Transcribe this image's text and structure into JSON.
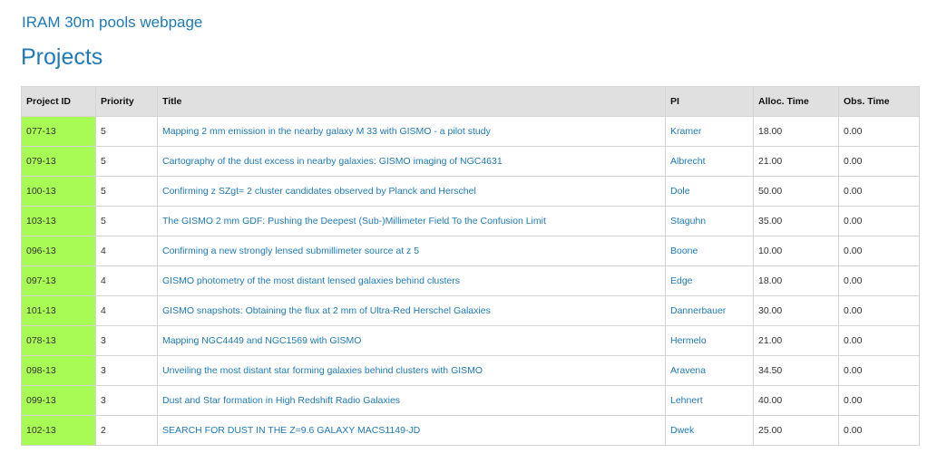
{
  "header": {
    "site_title": "IRAM 30m pools webpage",
    "page_title": "Projects"
  },
  "table": {
    "columns": [
      "Project ID",
      "Priority",
      "Title",
      "PI",
      "Alloc. Time",
      "Obs. Time"
    ],
    "rows": [
      {
        "project_id": "077-13",
        "priority": "5",
        "title": "Mapping 2 mm emission in the nearby galaxy M 33 with GISMO - a pilot study",
        "pi": "Kramer",
        "alloc_time": "18.00",
        "obs_time": "0.00"
      },
      {
        "project_id": "079-13",
        "priority": "5",
        "title": "Cartography of the dust excess in nearby galaxies: GISMO imaging of NGC4631",
        "pi": "Albrecht",
        "alloc_time": "21.00",
        "obs_time": "0.00"
      },
      {
        "project_id": "100-13",
        "priority": "5",
        "title": "Confirming z SZgt= 2 cluster candidates observed by Planck and Herschel",
        "pi": "Dole",
        "alloc_time": "50.00",
        "obs_time": "0.00"
      },
      {
        "project_id": "103-13",
        "priority": "5",
        "title": "The GISMO 2 mm GDF: Pushing the Deepest (Sub-)Millimeter Field To the Confusion Limit",
        "pi": "Staguhn",
        "alloc_time": "35.00",
        "obs_time": "0.00"
      },
      {
        "project_id": "096-13",
        "priority": "4",
        "title": "Confirming a new strongly lensed submillimeter source at z 5",
        "pi": "Boone",
        "alloc_time": "10.00",
        "obs_time": "0.00"
      },
      {
        "project_id": "097-13",
        "priority": "4",
        "title": "GISMO photometry of the most distant lensed galaxies behind clusters",
        "pi": "Edge",
        "alloc_time": "18.00",
        "obs_time": "0.00"
      },
      {
        "project_id": "101-13",
        "priority": "4",
        "title": "GISMO snapshots: Obtaining the flux at 2 mm of Ultra-Red Herschel Galaxies",
        "pi": "Dannerbauer",
        "alloc_time": "30.00",
        "obs_time": "0.00"
      },
      {
        "project_id": "078-13",
        "priority": "3",
        "title": "Mapping NGC4449 and NGC1569 with GISMO",
        "pi": "Hermelo",
        "alloc_time": "21.00",
        "obs_time": "0.00"
      },
      {
        "project_id": "098-13",
        "priority": "3",
        "title": "Unveiling the most distant star forming galaxies behind clusters with GISMO",
        "pi": "Aravena",
        "alloc_time": "34.50",
        "obs_time": "0.00"
      },
      {
        "project_id": "099-13",
        "priority": "3",
        "title": "Dust and Star formation in High Redshift Radio Galaxies",
        "pi": "Lehnert",
        "alloc_time": "40.00",
        "obs_time": "0.00"
      },
      {
        "project_id": "102-13",
        "priority": "2",
        "title": "SEARCH FOR DUST IN THE Z=9.6 GALAXY MACS1149-JD",
        "pi": "Dwek",
        "alloc_time": "25.00",
        "obs_time": "0.00"
      }
    ]
  },
  "colors": {
    "link": "#1f7ab5",
    "header_bg": "#e0e0e0",
    "project_id_bg": "#a8fb55"
  }
}
